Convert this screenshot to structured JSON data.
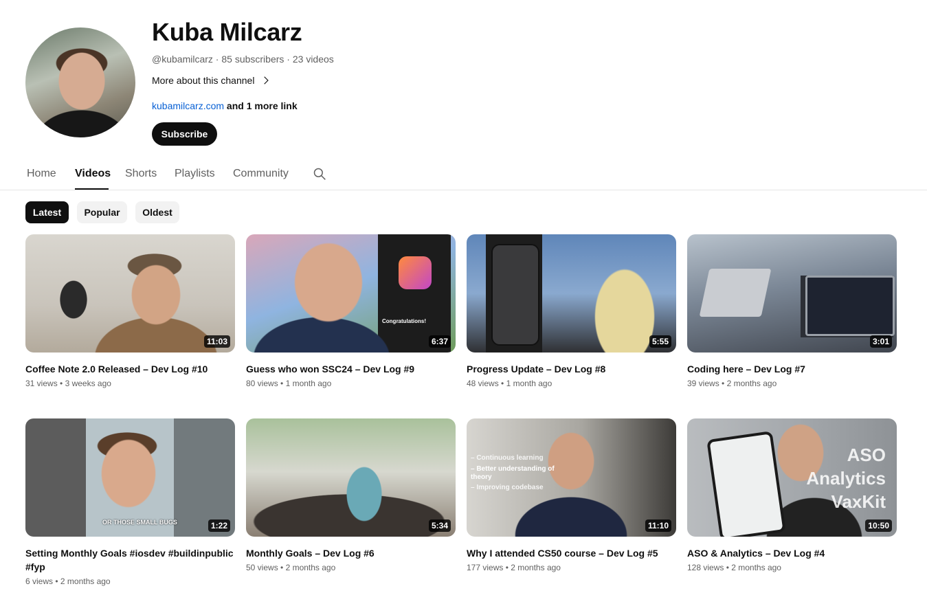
{
  "channel": {
    "name": "Kuba Milcarz",
    "handle": "@kubamilcarz",
    "subscribers": "85 subscribers",
    "videos_count": "23 videos",
    "separator": " · ",
    "more_about": "More about this channel",
    "link_text": "kubamilcarz.com",
    "more_links": "and 1 more link",
    "subscribe_label": "Subscribe"
  },
  "tabs": [
    {
      "label": "Home"
    },
    {
      "label": "Videos"
    },
    {
      "label": "Shorts"
    },
    {
      "label": "Playlists"
    },
    {
      "label": "Community"
    }
  ],
  "active_tab": "Videos",
  "chips": [
    {
      "label": "Latest"
    },
    {
      "label": "Popular"
    },
    {
      "label": "Oldest"
    }
  ],
  "active_chip": "Latest",
  "videos": [
    {
      "title": "Coffee Note 2.0 Released – Dev Log #10",
      "views": "31 views",
      "age": "3 weeks ago",
      "duration": "11:03"
    },
    {
      "title": "Guess who won SSC24 – Dev Log #9",
      "views": "80 views",
      "age": "1 month ago",
      "duration": "6:37",
      "overlay": "Congratulations!"
    },
    {
      "title": "Progress Update – Dev Log #8",
      "views": "48 views",
      "age": "1 month ago",
      "duration": "5:55"
    },
    {
      "title": "Coding here – Dev Log #7",
      "views": "39 views",
      "age": "2 months ago",
      "duration": "3:01"
    },
    {
      "title": "Setting Monthly Goals #iosdev #buildinpublic #fyp",
      "views": "6 views",
      "age": "2 months ago",
      "duration": "1:22",
      "overlay": "OR THOSE SMALL BUGS"
    },
    {
      "title": "Monthly Goals – Dev Log #6",
      "views": "50 views",
      "age": "2 months ago",
      "duration": "5:34"
    },
    {
      "title": "Why I attended CS50 course – Dev Log #5",
      "views": "177 views",
      "age": "2 months ago",
      "duration": "11:10",
      "overlay_lines": [
        "– Continuous learning",
        "– Better understanding of theory",
        "– Improving codebase"
      ]
    },
    {
      "title": "ASO & Analytics – Dev Log #4",
      "views": "128 views",
      "age": "2 months ago",
      "duration": "10:50",
      "overlay_lines": [
        "ASO",
        "Analytics",
        "VaxKit"
      ]
    }
  ],
  "stat_separator": " • "
}
